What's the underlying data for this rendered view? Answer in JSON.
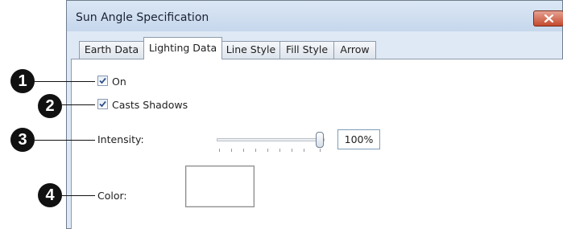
{
  "dialog": {
    "title": "Sun Angle Specification",
    "tabs": [
      {
        "label": "Earth Data",
        "active": false
      },
      {
        "label": "Lighting Data",
        "active": true
      },
      {
        "label": "Line Style",
        "active": false
      },
      {
        "label": "Fill Style",
        "active": false
      },
      {
        "label": "Arrow",
        "active": false
      }
    ],
    "on": {
      "label": "On",
      "checked": true
    },
    "casts_shadows": {
      "label": "Casts Shadows",
      "checked": true
    },
    "intensity": {
      "label": "Intensity:",
      "value": "100%",
      "slider_level": 1.0
    },
    "color": {
      "label": "Color:",
      "swatch": "#ffffff"
    }
  },
  "callouts": [
    "1",
    "2",
    "3",
    "4"
  ]
}
